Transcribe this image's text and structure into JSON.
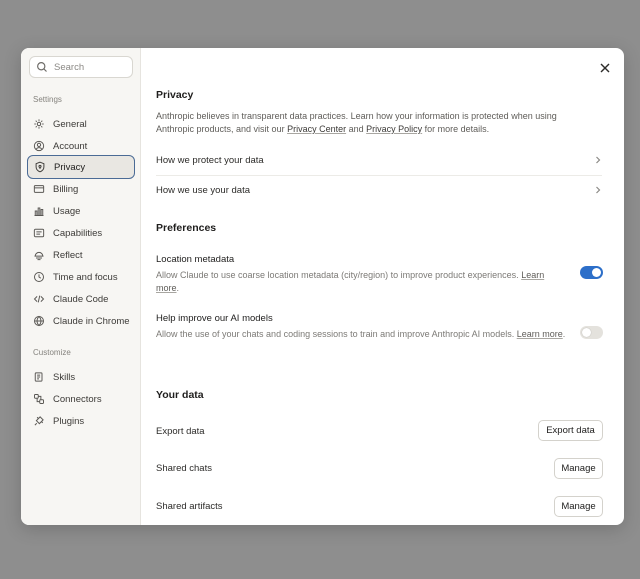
{
  "search": {
    "placeholder": "Search"
  },
  "sidebar": {
    "settings_label": "Settings",
    "customize_label": "Customize",
    "items": [
      {
        "label": "General",
        "icon": "gear-icon"
      },
      {
        "label": "Account",
        "icon": "user-circle-icon"
      },
      {
        "label": "Privacy",
        "icon": "shield-icon",
        "active": true
      },
      {
        "label": "Billing",
        "icon": "credit-card-icon"
      },
      {
        "label": "Usage",
        "icon": "bar-chart-icon"
      },
      {
        "label": "Capabilities",
        "icon": "sliders-icon"
      },
      {
        "label": "Reflect",
        "icon": "reflect-icon"
      },
      {
        "label": "Time and focus",
        "icon": "clock-icon"
      },
      {
        "label": "Claude Code",
        "icon": "code-icon"
      },
      {
        "label": "Claude in Chrome",
        "icon": "globe-icon"
      }
    ],
    "customize_items": [
      {
        "label": "Skills",
        "icon": "skills-icon"
      },
      {
        "label": "Connectors",
        "icon": "connectors-icon"
      },
      {
        "label": "Plugins",
        "icon": "plugin-icon"
      }
    ]
  },
  "privacy": {
    "title": "Privacy",
    "desc_1": "Anthropic believes in transparent data practices. Learn how your information is protected when using Anthropic products, and visit our ",
    "privacy_center_link": "Privacy Center",
    "desc_and": " and ",
    "privacy_policy_link": "Privacy Policy",
    "desc_end": " for more details.",
    "rows": [
      {
        "label": "How we protect your data"
      },
      {
        "label": "How we use your data"
      }
    ]
  },
  "preferences": {
    "title": "Preferences",
    "location": {
      "title": "Location metadata",
      "desc": "Allow Claude to use coarse location metadata (city/region) to improve product experiences. ",
      "link": "Learn more",
      "enabled": true
    },
    "improve": {
      "title": "Help improve our AI models",
      "desc": "Allow the use of your chats and coding sessions to train and improve Anthropic AI models. ",
      "link": "Learn more",
      "enabled": false
    }
  },
  "your_data": {
    "title": "Your data",
    "export_label": "Export data",
    "export_button": "Export data",
    "shared_chats_label": "Shared chats",
    "shared_chats_button": "Manage",
    "shared_artifacts_label": "Shared artifacts",
    "shared_artifacts_button": "Manage"
  },
  "colors": {
    "accent": "#2d6fc9",
    "active_border": "#4b6b95",
    "overlay": "#8e8e8e"
  }
}
